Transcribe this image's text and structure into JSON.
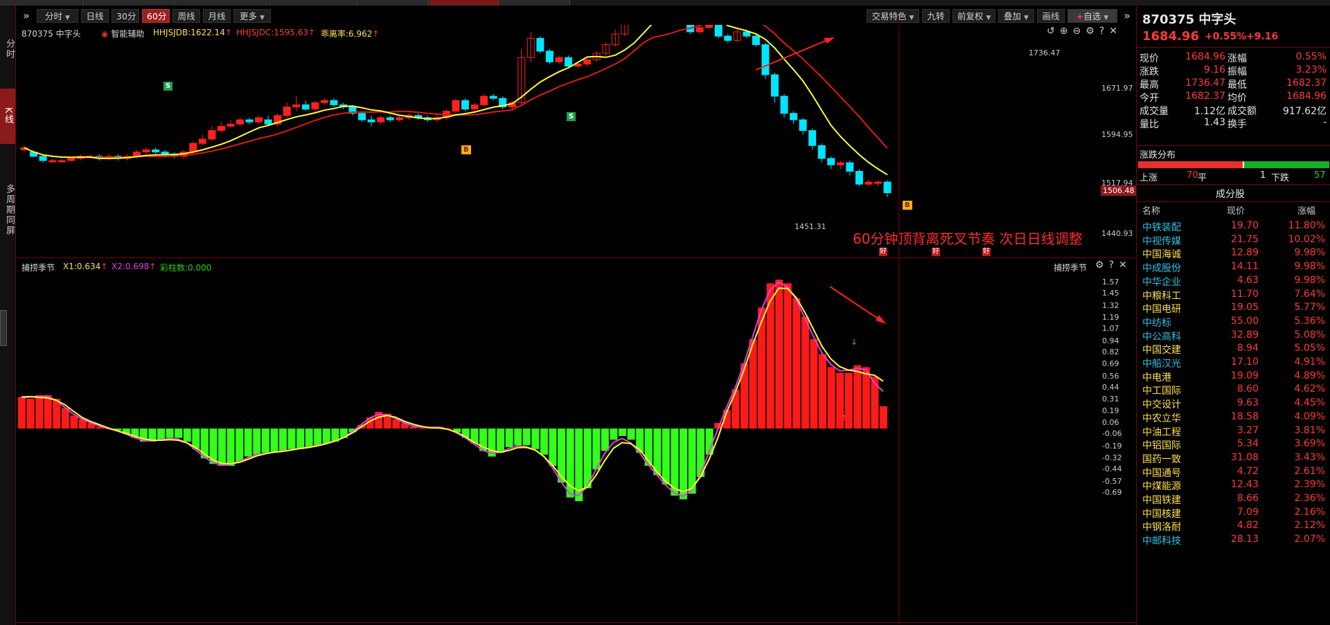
{
  "toolbar": {
    "periods": [
      "分时",
      "日线",
      "30分",
      "60分",
      "周线",
      "月线",
      "更多"
    ],
    "active_period": "60分",
    "right_buttons": [
      "交易特色",
      "九转",
      "前复权",
      "叠加",
      "画线",
      "自选"
    ]
  },
  "sidebar": {
    "tabs": [
      "分时",
      "K线",
      "多周期同屏"
    ],
    "active": "K线"
  },
  "main_chart": {
    "stock_label": "870375 中字头",
    "assist_label": "智能辅助",
    "indicators": [
      {
        "text": "HHJSJDB:1622.14",
        "color": "#ffe14d"
      },
      {
        "text": "HHJSJDC:1595.63",
        "color": "#ff3a3a"
      },
      {
        "text": "乖离率:6.962",
        "color": "#ffe14d"
      }
    ],
    "price_axis": [
      "1671.97",
      "1594.95",
      "1517.94",
      "1440.93"
    ],
    "current_price_tag": "1506.48",
    "high_label": "1736.47",
    "low_label": "1451.31",
    "annotation": "60分钟顶背离死叉节奏 次日日线调整",
    "buy_marker": "B",
    "sell_marker": "S",
    "bottom_markers": [
      "好",
      "好",
      "好"
    ]
  },
  "sub_chart": {
    "title": "捕捞季节",
    "indicators": [
      {
        "text": "X1:0.634",
        "color": "#ffe14d"
      },
      {
        "text": "X2:0.698",
        "color": "#e040e0"
      },
      {
        "text": "彩柱数:0.000",
        "color": "#25d400"
      }
    ],
    "axis": [
      "1.57",
      "1.45",
      "1.32",
      "1.19",
      "1.07",
      "0.94",
      "0.82",
      "0.69",
      "0.56",
      "0.44",
      "0.31",
      "0.19",
      "0.06",
      "-0.06",
      "-0.19",
      "-0.32",
      "-0.44",
      "-0.57",
      "-0.69"
    ]
  },
  "quote": {
    "code_name": "870375 中字头",
    "price": "1684.96",
    "pct": "+0.55%",
    "change": "+9.16",
    "fields": [
      {
        "l1": "现价",
        "v1": "1684.96",
        "l2": "涨幅",
        "v2": "0.55%",
        "c": "red"
      },
      {
        "l1": "涨跌",
        "v1": "9.16",
        "l2": "振幅",
        "v2": "3.23%",
        "c": "red"
      },
      {
        "l1": "最高",
        "v1": "1736.47",
        "l2": "最低",
        "v2": "1682.37",
        "c": "red"
      },
      {
        "l1": "今开",
        "v1": "1682.37",
        "l2": "均价",
        "v2": "1684.96",
        "c": "red"
      },
      {
        "l1": "成交量",
        "v1": "1.12亿",
        "l2": "成交额",
        "v2": "917.62亿",
        "c": "white"
      },
      {
        "l1": "量比",
        "v1": "1.43",
        "l2": "换手",
        "v2": "-",
        "c": "white"
      }
    ]
  },
  "distribution": {
    "title": "涨跌分布",
    "up_label": "上涨",
    "up": "70",
    "flat_label": "平",
    "flat": "1",
    "down_label": "下跌",
    "down": "57",
    "up_count": 70,
    "flat_count": 1,
    "down_count": 57
  },
  "constituents": {
    "title": "成分股",
    "headers": [
      "名称",
      "现价",
      "涨幅"
    ],
    "rows": [
      {
        "name": "中铁装配",
        "price": "19.70",
        "pct": "11.80%",
        "c": "cyan"
      },
      {
        "name": "中视传媒",
        "price": "21.75",
        "pct": "10.02%",
        "c": "cyan"
      },
      {
        "name": "中国海诚",
        "price": "12.89",
        "pct": "9.98%",
        "c": "yellow"
      },
      {
        "name": "中成股份",
        "price": "14.11",
        "pct": "9.98%",
        "c": "cyan"
      },
      {
        "name": "中华企业",
        "price": "4.63",
        "pct": "9.98%",
        "c": "cyan"
      },
      {
        "name": "中粮科工",
        "price": "11.70",
        "pct": "7.64%",
        "c": "yellow"
      },
      {
        "name": "中国电研",
        "price": "19.05",
        "pct": "5.77%",
        "c": "yellow"
      },
      {
        "name": "中纺标",
        "price": "55.00",
        "pct": "5.36%",
        "c": "cyan"
      },
      {
        "name": "中公高科",
        "price": "32.89",
        "pct": "5.08%",
        "c": "cyan"
      },
      {
        "name": "中国交建",
        "price": "8.94",
        "pct": "5.05%",
        "c": "yellow"
      },
      {
        "name": "中船汉光",
        "price": "17.10",
        "pct": "4.91%",
        "c": "cyan"
      },
      {
        "name": "中电港",
        "price": "19.09",
        "pct": "4.89%",
        "c": "yellow"
      },
      {
        "name": "中工国际",
        "price": "8.60",
        "pct": "4.62%",
        "c": "yellow"
      },
      {
        "name": "中交设计",
        "price": "9.63",
        "pct": "4.45%",
        "c": "yellow"
      },
      {
        "name": "中农立华",
        "price": "18.58",
        "pct": "4.09%",
        "c": "yellow"
      },
      {
        "name": "中油工程",
        "price": "3.27",
        "pct": "3.81%",
        "c": "yellow"
      },
      {
        "name": "中铝国际",
        "price": "5.34",
        "pct": "3.69%",
        "c": "yellow"
      },
      {
        "name": "国药一致",
        "price": "31.08",
        "pct": "3.43%",
        "c": "yellow"
      },
      {
        "name": "中国通号",
        "price": "4.72",
        "pct": "2.61%",
        "c": "yellow"
      },
      {
        "name": "中煤能源",
        "price": "12.43",
        "pct": "2.39%",
        "c": "yellow"
      },
      {
        "name": "中国铁建",
        "price": "8.66",
        "pct": "2.36%",
        "c": "yellow"
      },
      {
        "name": "中国核建",
        "price": "7.09",
        "pct": "2.16%",
        "c": "yellow"
      },
      {
        "name": "中钢洛耐",
        "price": "4.82",
        "pct": "2.12%",
        "c": "yellow"
      },
      {
        "name": "中邮科技",
        "price": "28.13",
        "pct": "2.07%",
        "c": "cyan"
      }
    ]
  },
  "colors": {
    "up": "#ff2020",
    "down": "#00e5ff",
    "ma_fast": "#ffff33",
    "ma_slow": "#e01818",
    "macd_up": "#ff1a1a",
    "macd_down": "#33ff1a",
    "x1": "#ffff33",
    "x2": "#e040e0"
  }
}
